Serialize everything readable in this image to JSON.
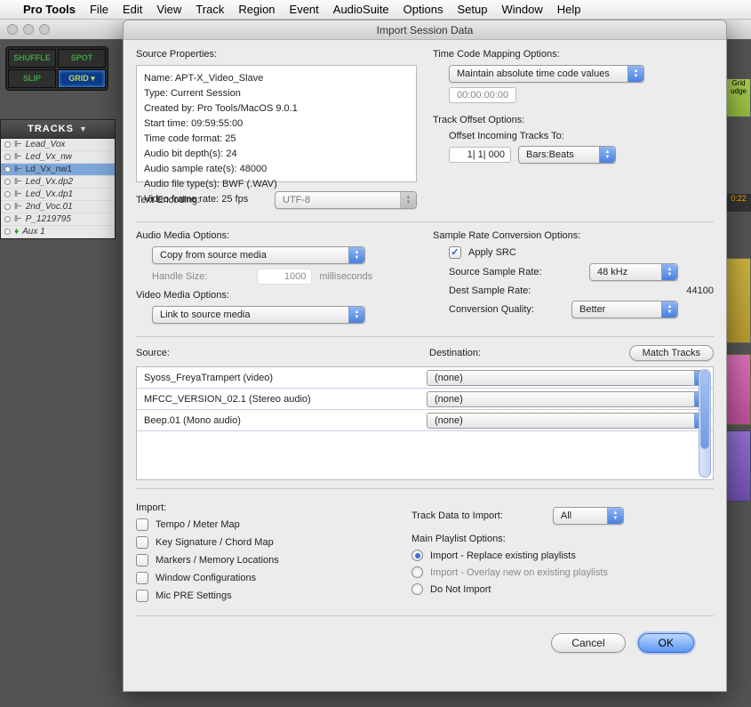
{
  "menubar": {
    "appname": "Pro Tools",
    "items": [
      "File",
      "Edit",
      "View",
      "Track",
      "Region",
      "Event",
      "AudioSuite",
      "Options",
      "Setup",
      "Window",
      "Help"
    ]
  },
  "modes": {
    "shuffle": "SHUFFLE",
    "spot": "SPOT",
    "slip": "SLIP",
    "grid": "GRID ▾"
  },
  "tracks_header": "TRACKS",
  "tracks": [
    {
      "name": "Lead_Vox"
    },
    {
      "name": "Led_Vx_nw"
    },
    {
      "name": "Ld_Vx_nw1",
      "active": true
    },
    {
      "name": "Led_Vx.dp2"
    },
    {
      "name": "Led_Vx.dp1"
    },
    {
      "name": "2nd_Voc.01"
    },
    {
      "name": "P_1219795"
    },
    {
      "name": "Aux 1",
      "aux": true
    }
  ],
  "dialog": {
    "title": "Import Session Data",
    "source_props_label": "Source Properties:",
    "props": {
      "name": "Name: APT-X_Video_Slave",
      "type": "Type: Current Session",
      "created": "Created by: Pro Tools/MacOS 9.0.1",
      "start": "Start time: 09:59:55:00",
      "tcf": "Time code format: 25",
      "bitdepth": "Audio bit depth(s): 24",
      "sr": "Audio sample rate(s): 48000",
      "ft": "Audio file type(s): BWF (.WAV)",
      "vfr": "Video frame rate: 25 fps"
    },
    "text_encoding_label": "Text Encoding:",
    "text_encoding_value": "UTF-8",
    "audio_media_label": "Audio Media Options:",
    "audio_media_value": "Copy from source media",
    "handle_label": "Handle Size:",
    "handle_value": "1000",
    "handle_units": "milliseconds",
    "video_media_label": "Video Media Options:",
    "video_media_value": "Link to source media",
    "tcmap_label": "Time Code Mapping Options:",
    "tcmap_value": "Maintain absolute time code values",
    "tcmap_time": "00:00:00:00",
    "trackoffset_label": "Track Offset Options:",
    "offset_incoming_label": "Offset Incoming Tracks To:",
    "offset_value": "1| 1| 000",
    "offset_unit": "Bars:Beats",
    "src_label": "Sample Rate Conversion Options:",
    "apply_src": "Apply SRC",
    "source_sr_label": "Source Sample Rate:",
    "source_sr_value": "48 kHz",
    "dest_sr_label": "Dest Sample Rate:",
    "dest_sr_value": "44100",
    "conv_q_label": "Conversion Quality:",
    "conv_q_value": "Better",
    "source_header": "Source:",
    "dest_header": "Destination:",
    "match_tracks": "Match Tracks",
    "rows": [
      {
        "src": "Syoss_FreyaTrampert (video)",
        "dest": "(none)"
      },
      {
        "src": "MFCC_VERSION_02.1 (Stereo audio)",
        "dest": "(none)"
      },
      {
        "src": "Beep.01 (Mono audio)",
        "dest": "(none)"
      }
    ],
    "import_label": "Import:",
    "import_opts": [
      "Tempo / Meter Map",
      "Key Signature / Chord Map",
      "Markers / Memory Locations",
      "Window Configurations",
      "Mic PRE Settings"
    ],
    "trackdata_label": "Track Data to Import:",
    "trackdata_value": "All",
    "mainpl_label": "Main Playlist Options:",
    "pl_replace": "Import - Replace existing playlists",
    "pl_overlay": "Import - Overlay new on existing playlists",
    "pl_none": "Do Not Import",
    "cancel": "Cancel",
    "ok": "OK"
  },
  "timeline": {
    "grid": "Grid",
    "udge": "udge",
    "tc": "0:22"
  }
}
